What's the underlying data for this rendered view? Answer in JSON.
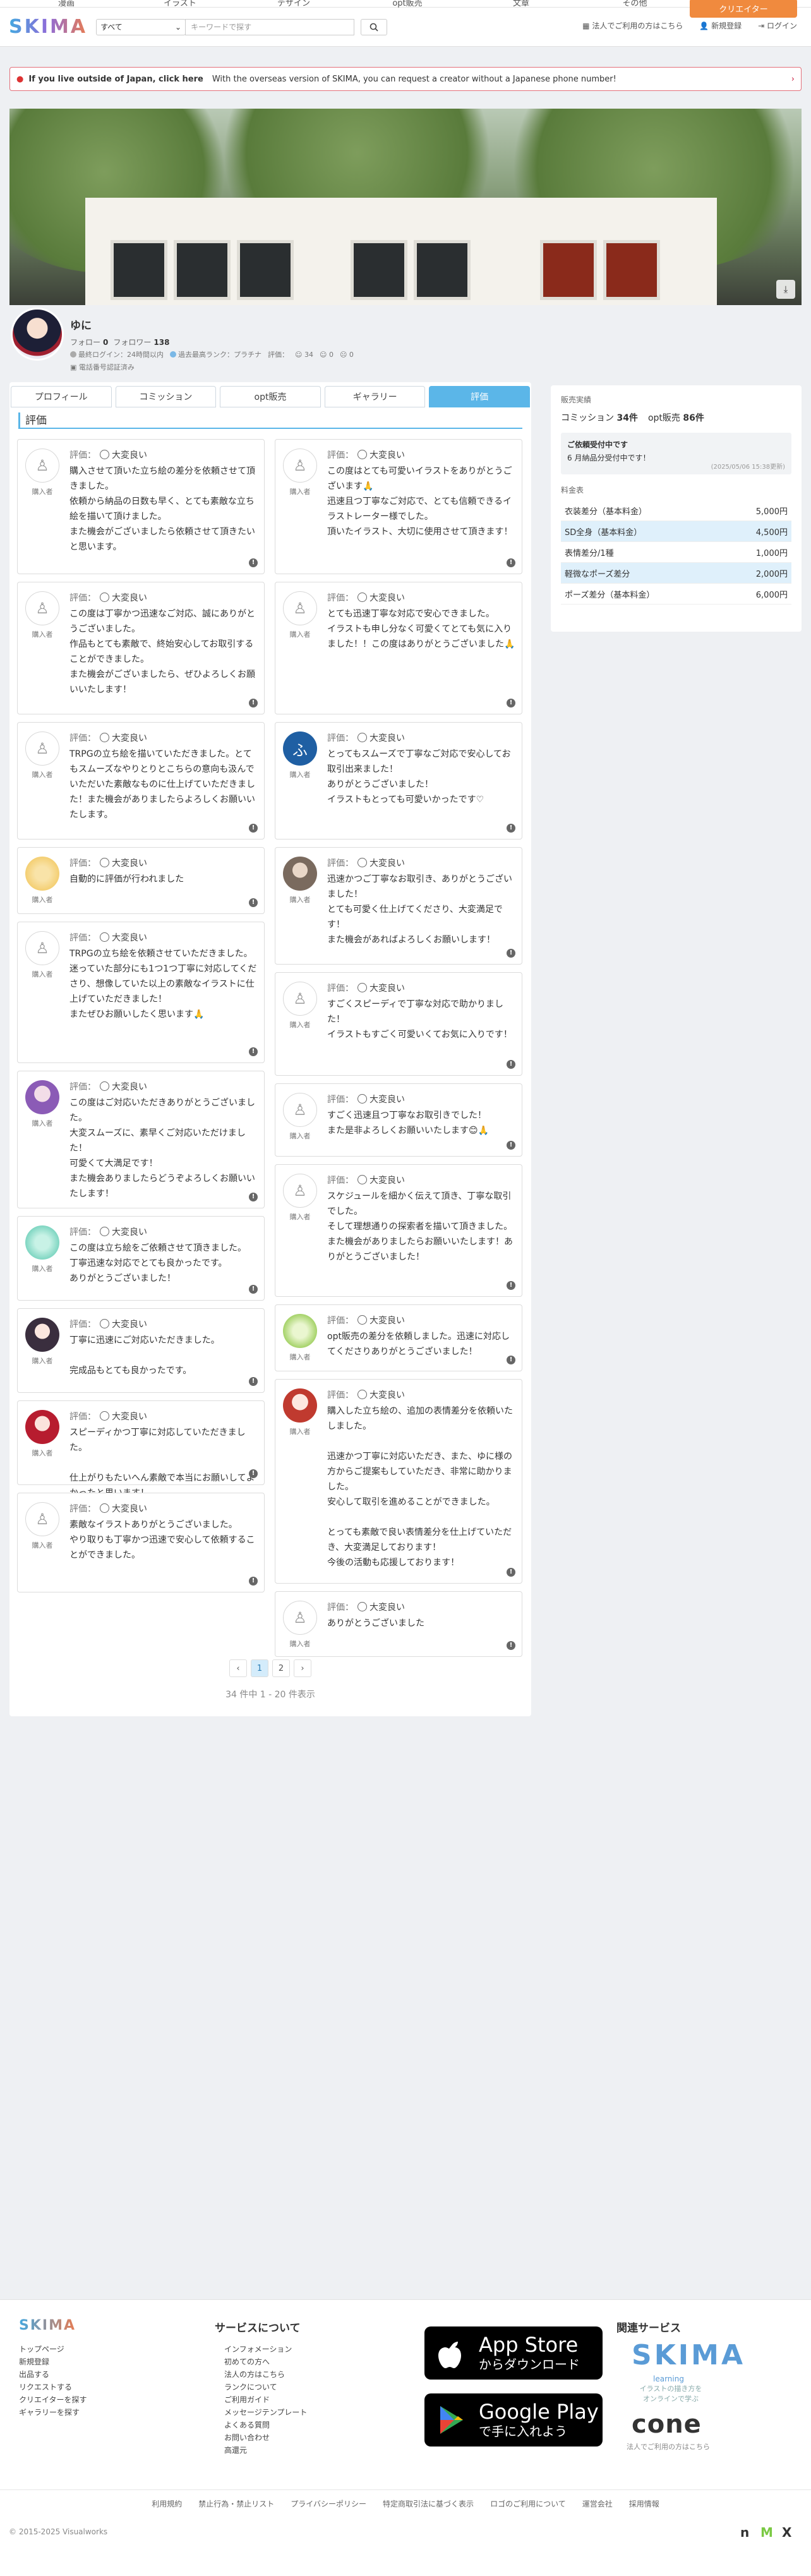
{
  "topnav": [
    "漫画",
    "イラスト",
    "デザイン",
    "opt販売",
    "文章",
    "その他"
  ],
  "top_button": "クリエイター",
  "header": {
    "logo": "SKIMA",
    "category": "すべて",
    "search_placeholder": "キーワードで探す",
    "corp_link": "法人でご利用の方はこちら",
    "signup": "新規登録",
    "login": "ログイン"
  },
  "banner": {
    "title": "If you live outside of Japan, click here",
    "text": "With the overseas version of SKIMA, you can request a creator without a Japanese phone number!"
  },
  "profile": {
    "name": "ゆに",
    "follow_label": "フォロー",
    "follow": "0",
    "follower_label": "フォロワー",
    "follower": "138",
    "last_login": "最終ログイン：24時間以内",
    "rank": "過去最高ランク：プラチナ",
    "eval_label": "評価：",
    "eval_good": "34",
    "eval_normal": "0",
    "eval_bad": "0",
    "phone": "電話番号認証済み"
  },
  "tabs": [
    "プロフィール",
    "コミッション",
    "opt販売",
    "ギャラリー",
    "評価"
  ],
  "section_title": "評価",
  "rating_label": "評価：",
  "rating_value": "大変良い",
  "buyer_label": "購入者",
  "reviews_left": [
    "購入させて頂いた立ち絵の差分を依頼させて頂きました。\n依頼から納品の日数も早く、とても素敵な立ち絵を描いて頂けました。\nまた機会がございましたら依頼させて頂きたいと思います。",
    "この度は丁寧かつ迅速なご対応、誠にありがとうございました。\n作品もとても素敵で、終始安心してお取引することができました。\nまた機会がございましたら、ぜひよろしくお願いいたします！",
    "TRPGの立ち絵を描いていただきました。とてもスムーズなやりとりとこちらの意向も汲んでいただいた素敵なものに仕上げていただきました！また機会がありましたらよろしくお願いいたします。",
    "自動的に評価が行われました",
    "TRPGの立ち絵を依頼させていただきました。\n迷っていた部分にも1つ1つ丁寧に対応してくださり、想像していた以上の素敵なイラストに仕上げていただきました！\nまたぜひお願いしたく思います🙏",
    "この度はご対応いただきありがとうございました。\n大変スムーズに、素早くご対応いただけました！\n可愛くて大満足です！\nまた機会ありましたらどうぞよろしくお願いいたします！",
    "この度は立ち絵をご依頼させて頂きました。\n丁寧迅速な対応でとても良かったです。\nありがとうございました！",
    "丁寧に迅速にご対応いただきました。\n\n完成品もとても良かったです。",
    "スピーディかつ丁寧に対応していただきました。\n\n仕上がりもたいへん素敵で本当にお願いしてよかったと思います！",
    "素敵なイラストありがとうございました。\nやり取りも丁寧かつ迅速で安心して依頼することができました。"
  ],
  "reviews_right": [
    "この度はとても可愛いイラストをありがとうございます🙏\n迅速且つ丁寧なご対応で、とても信頼できるイラストレーター様でした。\n頂いたイラスト、大切に使用させて頂きます！",
    "とても迅速丁寧な対応で安心できました。\nイラストも申し分なく可愛くてとても気に入りました！！この度はありがとうございました🙏",
    "とってもスムーズで丁寧なご対応で安心してお取引出来ました！\nありがとうございました！\nイラストもとっても可愛いかったです♡",
    "迅速かつご丁寧なお取引き、ありがとうございました！\nとても可愛く仕上げてくださり、大変満足です！\nまた機会があればよろしくお願いします！",
    "すごくスピーディで丁寧な対応で助かりました！\nイラストもすごく可愛いくてお気に入りです！",
    "すごく迅速且つ丁寧なお取引きでした！\nまた是非よろしくお願いいたします😊🙏",
    "スケジュールを細かく伝えて頂き、丁寧な取引でした。\nそして理想通りの探索者を描いて頂きました。\nまた機会がありましたらお願いいたします！ありがとうございました！",
    "opt販売の差分を依頼しました。迅速に対応してくださりありがとうございました！",
    "購入した立ち絵の、追加の表情差分を依頼いたしました。\n\n迅速かつ丁寧に対応いただき、また、ゆに様の方からご提案もしていただき、非常に助かりました。\n安心して取引を進めることができました。\n\nとっても素敵で良い表情差分を仕上げていただき、大変満足しております！\n今後の活動も応援しております！",
    "ありがとうございました"
  ],
  "pagination": {
    "prev": "‹",
    "pages": [
      "1",
      "2"
    ],
    "next": "›",
    "info": "34 件中 1 - 20 件表示"
  },
  "sidebar": {
    "title": "販売実績",
    "commission_label": "コミッション",
    "commission": "34件",
    "opt_label": "opt販売",
    "opt": "86件",
    "status_title": "ご依頼受付中です",
    "status_text": "6 月納品分受付中です！",
    "status_date": "(2025/05/06 15:38更新)",
    "price_title": "料金表",
    "prices": [
      {
        "name": "衣装差分（基本料金）",
        "price": "5,000円"
      },
      {
        "name": "SD全身（基本料金）",
        "price": "4,500円"
      },
      {
        "name": "表情差分/1種",
        "price": "1,000円"
      },
      {
        "name": "軽微なポーズ差分",
        "price": "2,000円"
      },
      {
        "name": "ポーズ差分（基本料金）",
        "price": "6,000円"
      }
    ]
  },
  "footer": {
    "logo": "SKIMA",
    "links1": [
      "トップページ",
      "新規登録",
      "出品する",
      "リクエストする",
      "クリエイターを探す",
      "ギャラリーを探す"
    ],
    "about_title": "サービスについて",
    "links2": [
      "インフォメーション",
      "初めての方へ",
      "法人の方はこちら",
      "ランクについて",
      "ご利用ガイド",
      "メッセージテンプレート",
      "よくある質問",
      "お問い合わせ",
      "高還元"
    ],
    "appstore1": "App Store",
    "appstore2": "からダウンロード",
    "gplay1": "Google Play",
    "gplay2": "で手に入れよう",
    "related_title": "関連サービス",
    "skl": "SKIMA",
    "skl_sub": "learning",
    "skl_desc": "イラストの描き方を\nオンラインで学ぶ",
    "cone": "cone",
    "cone_desc": "法人でご利用の方はこちら",
    "bar": [
      "利用規約",
      "禁止行為・禁止リスト",
      "プライバシーポリシー",
      "特定商取引法に基づく表示",
      "ロゴのご利用について",
      "運営会社",
      "採用情報"
    ],
    "copyright": "© 2015-2025 Visualworks"
  },
  "colors": {
    "accent": "#5bb6e8",
    "orange": "#f08a3e",
    "alert": "#e3707a"
  }
}
